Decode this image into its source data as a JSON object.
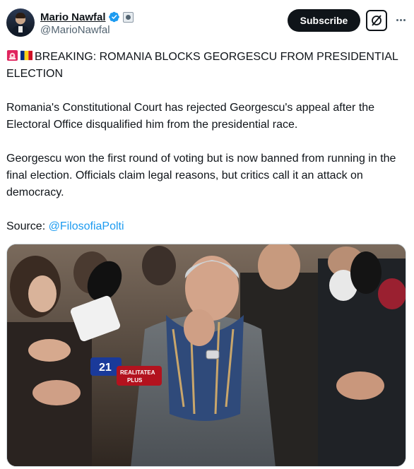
{
  "tweet": {
    "author": {
      "name": "Mario Nawfal",
      "handle": "@MarioNawfal",
      "verified_icon": "verified-badge-icon",
      "affiliation_icon": "affiliate-badge-icon"
    },
    "actions": {
      "subscribe_label": "Subscribe",
      "grok_icon": "grok-icon",
      "more_icon": "more-dots-icon"
    },
    "text": {
      "headline": "BREAKING: ROMANIA BLOCKS GEORGESCU FROM PRESIDENTIAL ELECTION",
      "paragraph_1": "Romania's Constitutional Court has rejected Georgescu's appeal after the Electoral Office disqualified him from the presidential race.",
      "paragraph_2": "Georgescu won the first round of voting but is now banned from running in the final election. Officials claim legal reasons, but critics call it an attack on democracy.",
      "source_label": "Source: ",
      "source_link": "@FilosofiaPolti",
      "emojis": [
        "siren-emoji",
        "romania-flag-emoji"
      ]
    },
    "media": {
      "description_icon": "photo",
      "mic_labels": [
        "REALITATEA PLUS",
        "21"
      ]
    }
  },
  "colors": {
    "text": "#0f1419",
    "muted": "#536471",
    "link": "#1d9bf0",
    "verified": "#1d9bf0",
    "button": "#0f1419"
  }
}
